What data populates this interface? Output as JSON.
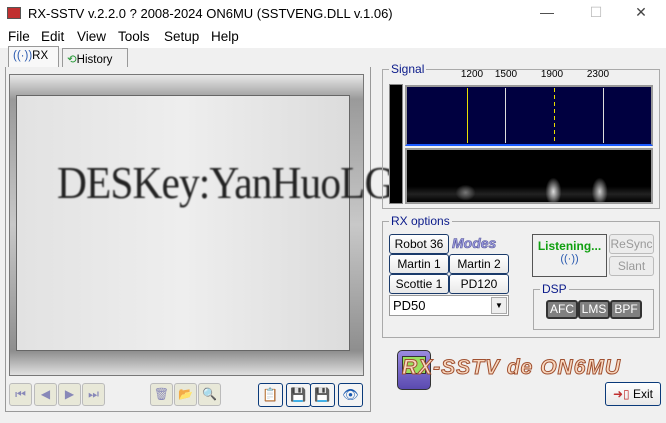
{
  "window": {
    "title": "RX-SSTV v.2.2.0 ? 2008-2024 ON6MU (SSTVENG.DLL v.1.06)",
    "minimize": "—",
    "maximize": "☐",
    "close": "✕"
  },
  "menu": [
    "File",
    "Edit",
    "View",
    "Tools",
    "Setup",
    "Help"
  ],
  "tabs": [
    {
      "label": "RX",
      "icon": "antenna-icon"
    },
    {
      "label": "History",
      "icon": "history-clock-icon"
    }
  ],
  "image": {
    "text": "DESKey:YanHuoLG"
  },
  "nav": {
    "first": "⏮",
    "prev": "◀",
    "next": "▶",
    "last": "⏭"
  },
  "tools": {
    "delete": "🗑",
    "open": "📂",
    "zoom": "🔍",
    "copy": "📋",
    "save": "💾",
    "save_as": "💾",
    "view": "👁"
  },
  "signal": {
    "label": "Signal",
    "ticks": [
      "1200",
      "1500",
      "1900",
      "2300"
    ],
    "colors": {
      "spectrum_bg": "#000040",
      "marker": "#e8e000"
    }
  },
  "rx_options": {
    "label": "RX options",
    "modes_logo": "Modes",
    "buttons": [
      "Robot 36",
      "Martin 1",
      "Martin 2",
      "Scottie 1",
      "PD120"
    ],
    "mode_select": "PD50",
    "status": "Listening...",
    "resync": "ReSync",
    "slant": "Slant"
  },
  "dsp": {
    "label": "DSP",
    "buttons": [
      "AFC",
      "LMS",
      "BPF"
    ]
  },
  "logo": "RX-SSTV de ON6MU",
  "exit": "Exit"
}
